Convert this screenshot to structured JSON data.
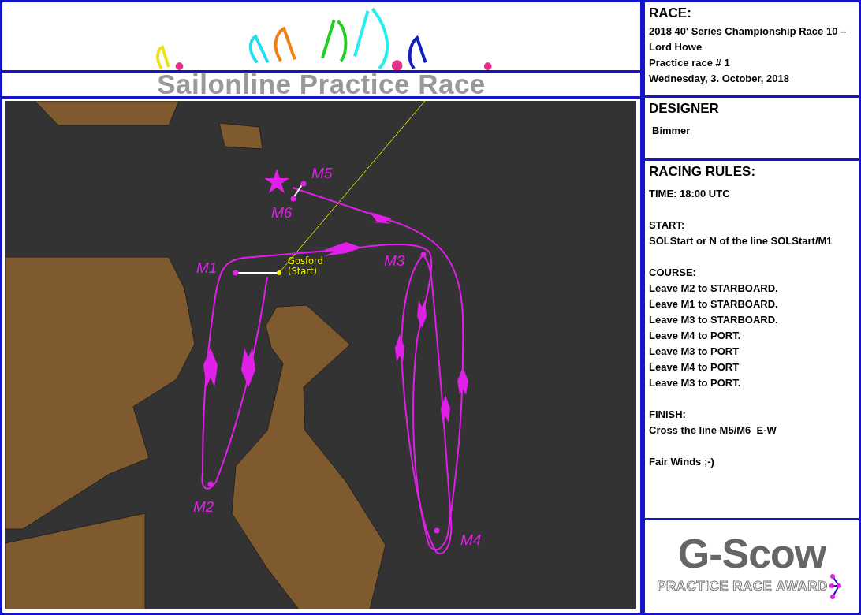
{
  "header": {
    "title": "Sailonline Practice Race"
  },
  "map": {
    "marks": [
      {
        "label": "M1"
      },
      {
        "label": "M2"
      },
      {
        "label": "M3"
      },
      {
        "label": "M4"
      },
      {
        "label": "M5"
      },
      {
        "label": "M6"
      }
    ],
    "start": {
      "lines": [
        "Gosford",
        "(Start)"
      ]
    }
  },
  "race": {
    "heading": "RACE:",
    "lines": [
      "2018 40' Series Championship Race 10 – Lord Howe",
      "Practice race # 1",
      "Wednesday, 3. October, 2018"
    ]
  },
  "designer": {
    "heading": "DESIGNER",
    "name": "Bimmer"
  },
  "rules": {
    "heading": "RACING RULES:",
    "blocks": [
      [
        "TIME: 18:00 UTC"
      ],
      [
        "START:",
        "SOLStart or N of the line SOLStart/M1"
      ],
      [
        "COURSE:",
        "Leave M2 to STARBOARD.",
        "Leave M1 to STARBOARD.",
        "Leave M3 to STARBOARD.",
        "Leave M4 to PORT.",
        "Leave M3 to PORT",
        "Leave M4 to PORT",
        "Leave M3 to PORT."
      ],
      [
        "FINISH:",
        "Cross the line M5/M6  E-W"
      ],
      [
        "Fair Winds ;-)"
      ]
    ]
  },
  "award": {
    "title": "G-Scow",
    "subtitle": "PRACTICE RACE AWARD"
  }
}
